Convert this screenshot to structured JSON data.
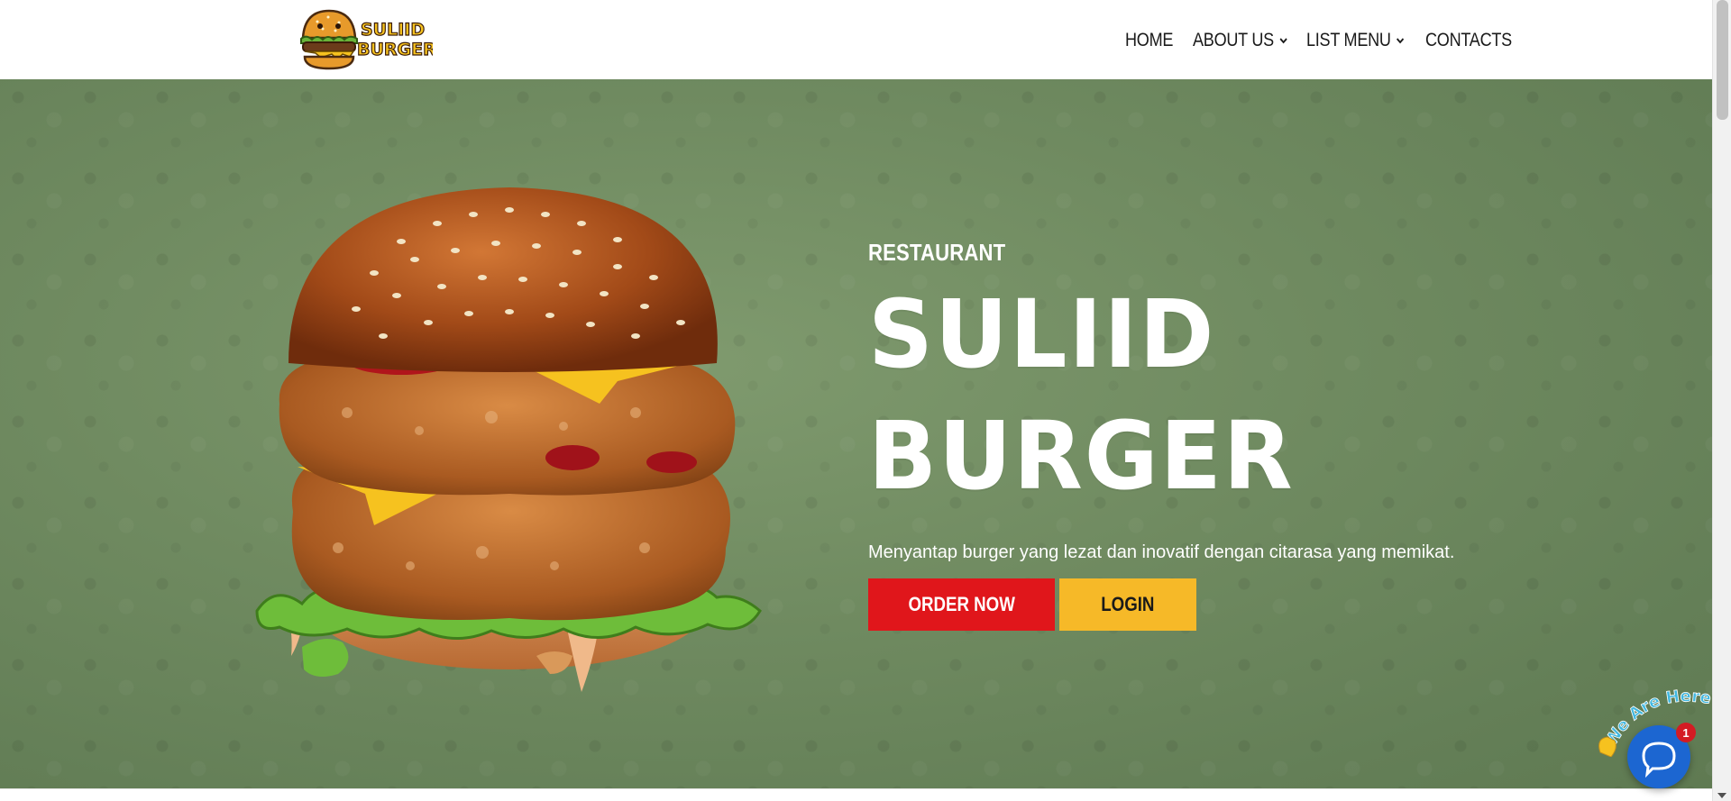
{
  "header": {
    "logo_text_line1": "SULIID",
    "logo_text_line2": "BURGER",
    "nav": [
      {
        "label": "HOME",
        "has_dropdown": false
      },
      {
        "label": "ABOUT US",
        "has_dropdown": true
      },
      {
        "label": "LIST MENU",
        "has_dropdown": true
      },
      {
        "label": "CONTACTS",
        "has_dropdown": true
      }
    ]
  },
  "hero": {
    "eyebrow": "RESTAURANT",
    "title_line1": "SULIID",
    "title_line2": "BURGER",
    "tagline": "Menyantap burger yang lezat dan inovatif dengan citarasa yang memikat.",
    "buttons": {
      "order_label": "ORDER NOW",
      "login_label": "LOGIN"
    },
    "colors": {
      "background": "#6f8a60",
      "order_button": "#e0161b",
      "login_button": "#f6b928"
    }
  },
  "chat_widget": {
    "caption": "We Are Here!",
    "badge_count": "1",
    "icon": "chat-bubble-icon",
    "color": "#1c66d1"
  }
}
